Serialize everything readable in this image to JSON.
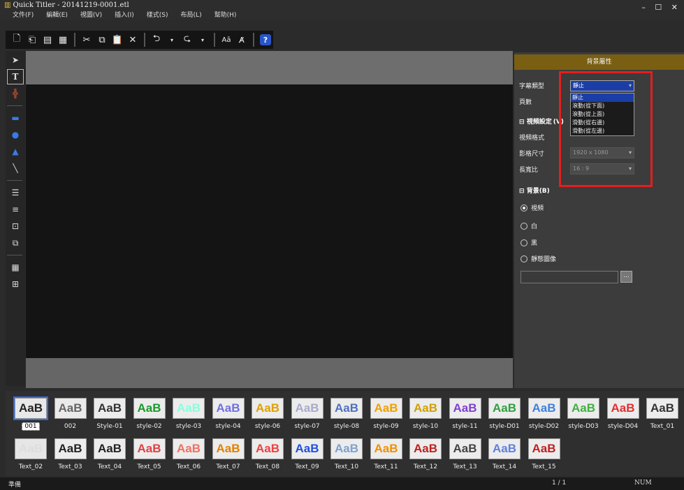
{
  "window": {
    "title": "Quick Titler - 20141219-0001.etl",
    "controls": "– ☐ ✕"
  },
  "menu": [
    "文件(F)",
    "編輯(E)",
    "視圖(V)",
    "插入(I)",
    "樣式(S)",
    "布局(L)",
    "幫助(H)"
  ],
  "toolbar": {
    "icons": [
      "new-icon",
      "open-icon",
      "save-icon",
      "save-as-icon",
      "cut-icon",
      "copy-icon",
      "paste-icon",
      "delete-icon",
      "undo-icon",
      "redo-icon",
      "font-icon",
      "text-style-icon",
      "help-icon"
    ]
  },
  "panel": {
    "header": "背景屬性",
    "subtitle_type_label": "字幕類型",
    "subtitle_type_value": "靜止",
    "dropdown_options": [
      "靜止",
      "滾動(從下面)",
      "滾動(從上面)",
      "滑動(從右邊)",
      "滑動(從左邊)"
    ],
    "pages_label": "頁數",
    "video_section": "視頻設定",
    "video_section_suffix": "(V)",
    "video_format_label": "視頻格式",
    "frame_size_label": "影格尺寸",
    "frame_size_value": "1920 x 1080",
    "aspect_label": "長寬比",
    "aspect_value": "16 : 9",
    "background_section": "背景(B)",
    "bg_options": [
      "視頻",
      "白",
      "黑",
      "靜態圖像"
    ],
    "bg_selected": "視頻",
    "browse_label": "..."
  },
  "styles": {
    "row1": [
      "001",
      "002",
      "Style-01",
      "style-02",
      "style-03",
      "style-04",
      "style-06",
      "style-07",
      "style-08",
      "style-09",
      "style-10",
      "style-11",
      "style-D01",
      "style-D02",
      "style-D03",
      "style-D04",
      "Text_01"
    ],
    "row2": [
      "Text_02",
      "Text_03",
      "Text_04",
      "Text_05",
      "Text_06",
      "Text_07",
      "Text_08",
      "Text_09",
      "Text_10",
      "Text_11",
      "Text_12",
      "Text_13",
      "Text_14",
      "Text_15"
    ],
    "sample": "AaB",
    "selected": "001"
  },
  "status": {
    "text": "準備",
    "page": "1 / 1",
    "num": "NUM"
  },
  "colors": {
    "panel_header": "#7a5f12",
    "highlight": "#e41e1e",
    "select_blue": "#1b3ea6"
  }
}
